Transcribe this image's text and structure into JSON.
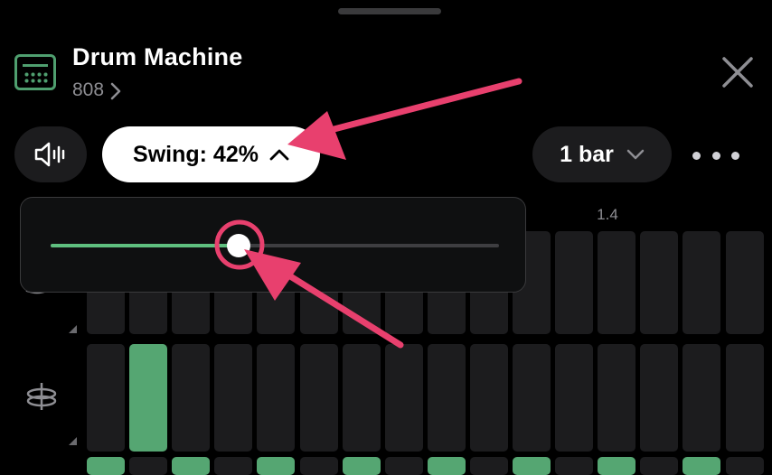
{
  "header": {
    "title": "Drum Machine",
    "kit_name": "808",
    "icon": "drum-machine-icon",
    "accent_color": "#4f9f6f"
  },
  "toolbar": {
    "volume_icon": "speaker-icon",
    "swing_label": "Swing: 42%",
    "swing_value": 42,
    "length_label": "1 bar",
    "more_icon": "ellipsis-icon"
  },
  "grid": {
    "step_label": "1.4",
    "tracks": [
      {
        "icon": "snare-icon",
        "steps": [
          0,
          0,
          0,
          0,
          0,
          0,
          0,
          0,
          0,
          0,
          0,
          0,
          0,
          0,
          0,
          0
        ]
      },
      {
        "icon": "cymbal-icon",
        "steps": [
          0,
          1,
          0,
          0,
          0,
          0,
          0,
          0,
          0,
          0,
          0,
          0,
          0,
          0,
          0,
          0
        ]
      },
      {
        "icon": "kick-icon",
        "steps": [
          1,
          0,
          1,
          0,
          1,
          0,
          1,
          0,
          1,
          0,
          1,
          0,
          1,
          0,
          1,
          0
        ]
      }
    ],
    "active_color": "#55a672"
  },
  "popover": {
    "slider_value": 42
  }
}
